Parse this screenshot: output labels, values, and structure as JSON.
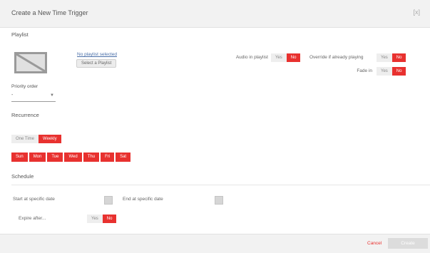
{
  "dialog": {
    "title": "Create a New Time Trigger",
    "close_label": "[x]"
  },
  "playlist": {
    "section_label": "Playlist",
    "selected_name": "No playlist selected",
    "select_button": "Select a Playlist"
  },
  "options": {
    "audio": {
      "label": "Audio in playlist",
      "yes": "Yes",
      "no": "No",
      "selected": "No"
    },
    "override": {
      "label": "Override if already playing",
      "yes": "Yes",
      "no": "No",
      "selected": "No"
    },
    "fade": {
      "label": "Fade in",
      "yes": "Yes",
      "no": "No",
      "selected": "No"
    }
  },
  "priority": {
    "label": "Priority order",
    "value": "-"
  },
  "recurrence": {
    "label": "Recurrence",
    "modes": [
      "One Time",
      "Weekly"
    ],
    "selected": "Weekly",
    "days": [
      "Sun",
      "Mon",
      "Tue",
      "Wed",
      "Thu",
      "Fri",
      "Sat"
    ]
  },
  "schedule": {
    "label": "Schedule",
    "start_label": "Start at specific date",
    "end_label": "End at specific date",
    "expire_label": "Expire after...",
    "expire_yes": "Yes",
    "expire_no": "No",
    "expire_selected": "No"
  },
  "footer": {
    "cancel": "Cancel",
    "create": "Create"
  }
}
